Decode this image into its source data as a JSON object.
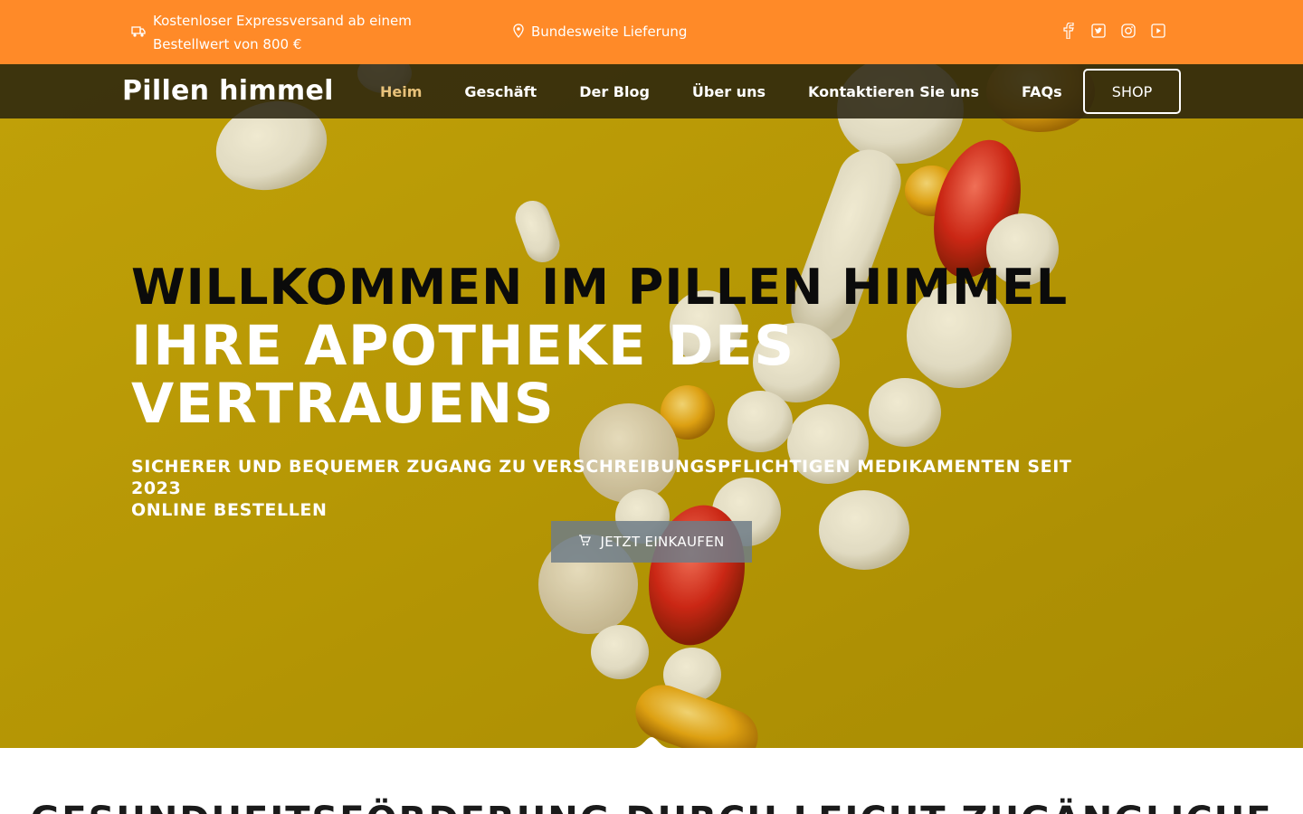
{
  "topbar": {
    "bg_color": "#ff8a28",
    "shipping_icon": "truck-icon",
    "shipping_text": "Kostenloser Expressversand ab einem Bestellwert von 800 €",
    "delivery_icon": "map-marker-icon",
    "delivery_text": "Bundesweite Lieferung",
    "social_icons": [
      "facebook-icon",
      "twitter-icon",
      "instagram-icon",
      "youtube-icon"
    ]
  },
  "navbar": {
    "brand": "Pillen himmel",
    "items": [
      {
        "label": "Heim",
        "active": true
      },
      {
        "label": "Geschäft",
        "active": false
      },
      {
        "label": "Der Blog",
        "active": false
      },
      {
        "label": "Über uns",
        "active": false
      },
      {
        "label": "Kontaktieren Sie uns",
        "active": false
      },
      {
        "label": "FAQs",
        "active": false
      }
    ],
    "shop_label": "SHOP"
  },
  "hero": {
    "title_line1": "WILLKOMMEN IM PILLEN HIMMEL",
    "title_line2": "IHRE APOTHEKE DES VERTRAUENS",
    "subtitle_line1": "SICHERER UND BEQUEMER ZUGANG ZU VERSCHREIBUNGSPFLICHTIGEN MEDIKAMENTEN SEIT 2023",
    "subtitle_line2": "ONLINE BESTELLEN",
    "cta_icon": "shopping-cart-icon",
    "cta_label": "JETZT EINKAUFEN",
    "bg_color": "#b69a07"
  },
  "next_section": {
    "title": "GESUNDHEITSFÖRDERUNG DURCH LEICHT ZUGÄNGLICHE"
  }
}
